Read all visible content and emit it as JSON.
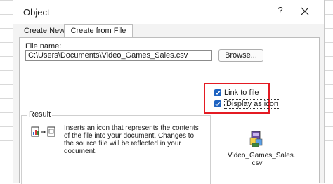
{
  "window": {
    "title": "Object",
    "help_label": "?",
    "close_icon": "close-icon"
  },
  "tabs": [
    {
      "label": "Create New",
      "selected": false
    },
    {
      "label": "Create from File",
      "selected": true
    }
  ],
  "file": {
    "label": "File name:",
    "value": "C:\\Users\\Documents\\Video_Games_Sales.csv",
    "browse_label": "Browse..."
  },
  "options": {
    "link_label": "Link to file",
    "link_checked": true,
    "display_label": "Display as icon",
    "display_checked": true,
    "highlight_color": "#e41b23",
    "check_color": "#1c62c1"
  },
  "result": {
    "legend": "Result",
    "text": "Inserts an icon that represents the contents of the file into your document. Changes to the source file will be reflected in your document."
  },
  "preview": {
    "line1": "Video_Games_Sales.",
    "line2": "csv"
  }
}
